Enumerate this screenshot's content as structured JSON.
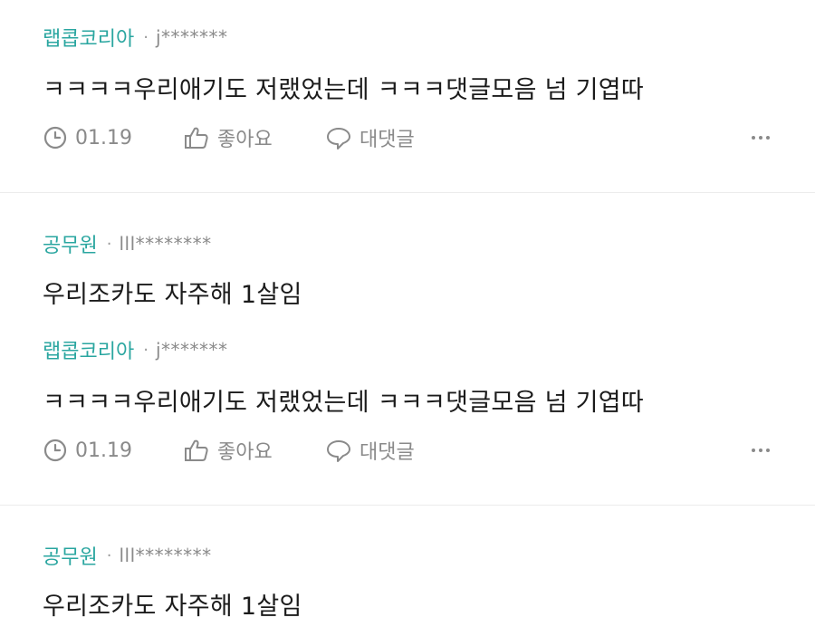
{
  "comments": [
    {
      "author": "랩콥코리아",
      "separator": "·",
      "user_id": "j*******",
      "text": "ㅋㅋㅋㅋ우리애기도 저랬었는데 ㅋㅋㅋ댓글모음 넘 기엽따",
      "date": "01.19",
      "like_label": "좋아요",
      "reply_label": "대댓글"
    },
    {
      "author": "공무원",
      "separator": "·",
      "user_id": "lll********",
      "text": "우리조카도 자주해 1살임"
    },
    {
      "author": "랩콥코리아",
      "separator": "·",
      "user_id": "j*******",
      "text": "ㅋㅋㅋㅋ우리애기도 저랬었는데 ㅋㅋㅋ댓글모음 넘 기엽따",
      "date": "01.19",
      "like_label": "좋아요",
      "reply_label": "대댓글"
    },
    {
      "author": "공무원",
      "separator": "·",
      "user_id": "lll********",
      "text": "우리조카도 자주해 1살임"
    }
  ],
  "icons": {
    "time": "clock-icon",
    "like": "thumbs-up-icon",
    "reply": "speech-bubble-icon",
    "more": "more-dots-icon"
  },
  "colors": {
    "author": "#2aa6a0",
    "meta": "#8a8a8a",
    "text": "#1b1b1b",
    "divider": "#ececec"
  }
}
